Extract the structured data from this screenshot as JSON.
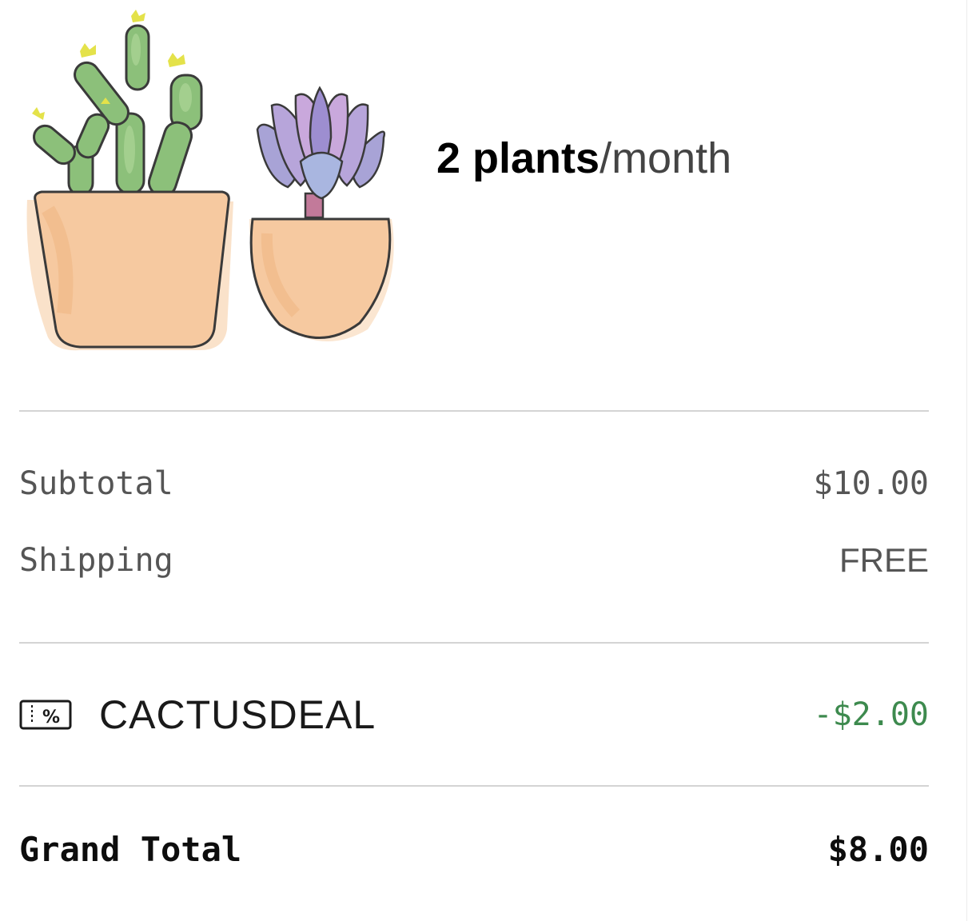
{
  "plan": {
    "quantity": "2 plants",
    "period": "/month",
    "illustration_icon": "potted-cactus-and-succulent-icon"
  },
  "summary": {
    "subtotal_label": "Subtotal",
    "subtotal_value": "$10.00",
    "shipping_label": "Shipping",
    "shipping_value": "FREE"
  },
  "discount": {
    "icon": "coupon-percent-icon",
    "code": "CACTUSDEAL",
    "amount": "-$2.00"
  },
  "total": {
    "label": "Grand Total",
    "value": "$8.00"
  },
  "colors": {
    "discount_green": "#3d8a4e",
    "divider": "#d4d4d4",
    "muted_text": "#555555",
    "pot": "#f6c9a0"
  }
}
